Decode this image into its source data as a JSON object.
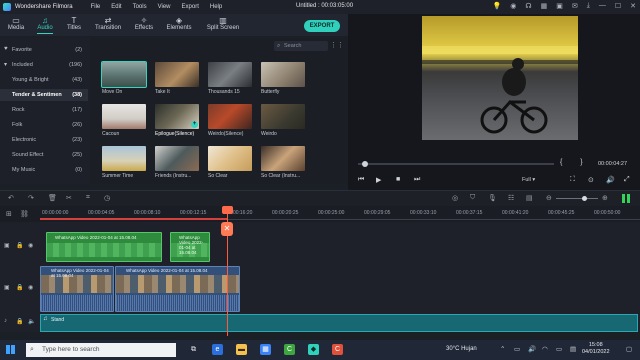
{
  "titlebar": {
    "app_name": "Wondershare Filmora",
    "menu": [
      "File",
      "Edit",
      "Tools",
      "View",
      "Export",
      "Help"
    ],
    "document": "Untitled : 00:03:05:00"
  },
  "toolbar": {
    "tabs": [
      {
        "label": "Media",
        "icon": "folder-icon"
      },
      {
        "label": "Audio",
        "icon": "music-note-icon"
      },
      {
        "label": "Titles",
        "icon": "text-icon"
      },
      {
        "label": "Transition",
        "icon": "transition-icon"
      },
      {
        "label": "Effects",
        "icon": "effects-icon"
      },
      {
        "label": "Elements",
        "icon": "elements-icon"
      },
      {
        "label": "Split Screen",
        "icon": "split-screen-icon"
      }
    ],
    "active_tab": "Audio",
    "export_label": "EXPORT"
  },
  "sidebar": {
    "items": [
      {
        "label": "Favorite",
        "count": "(2)"
      },
      {
        "label": "Included",
        "count": "(196)"
      },
      {
        "label": "Young & Bright",
        "count": "(43)"
      },
      {
        "label": "Tender & Sentimen",
        "count": "(38)"
      },
      {
        "label": "Rock",
        "count": "(17)"
      },
      {
        "label": "Folk",
        "count": "(26)"
      },
      {
        "label": "Electronic",
        "count": "(23)"
      },
      {
        "label": "Sound Effect",
        "count": "(25)"
      },
      {
        "label": "My Music",
        "count": "(0)"
      }
    ]
  },
  "media": {
    "search_placeholder": "Search",
    "items": [
      {
        "label": "Move On"
      },
      {
        "label": "Take It"
      },
      {
        "label": "Thousands 15"
      },
      {
        "label": "Butterfly"
      },
      {
        "label": "Cacoun"
      },
      {
        "label": "Epilogue(Silence)"
      },
      {
        "label": "Weirdo(Silence)"
      },
      {
        "label": "Weirdo"
      },
      {
        "label": "Summer Time"
      },
      {
        "label": "Friends (Instru..."
      },
      {
        "label": "So Clear"
      },
      {
        "label": "So Clear (Instru..."
      }
    ]
  },
  "preview": {
    "time": "00:00:04:27",
    "quality": "Full"
  },
  "ruler": {
    "labels": [
      "00:00:00:00",
      "00:00:04:05",
      "00:00:08:10",
      "00:00:12:15",
      "00:00:16:20",
      "00:00:20:25",
      "00:00:25:00",
      "00:00:29:05",
      "00:00:33:10",
      "00:00:37:15",
      "00:00:41:20",
      "00:00:45:25",
      "00:00:50:00"
    ]
  },
  "timeline": {
    "audio_clip": "Stand",
    "clip_label": "WhatsApp Video 2022-01-04 at 15.08.04"
  },
  "taskbar": {
    "search_placeholder": "Type here to search",
    "weather": "30°C  Hujan",
    "time": "15:08",
    "date": "04/01/2022"
  }
}
